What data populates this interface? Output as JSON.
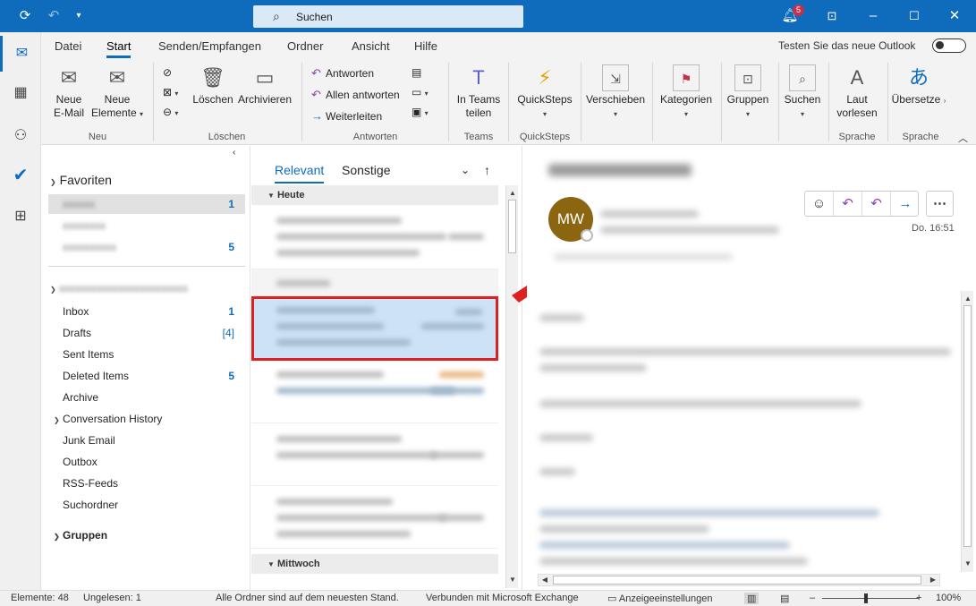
{
  "titlebar": {
    "search_label": "Suchen",
    "notification_count": "5",
    "icons": [
      "sync-icon",
      "undo-icon",
      "customize-icon",
      "bell-icon",
      "ribbon-display-icon",
      "minimize-icon",
      "maximize-icon",
      "close-icon"
    ]
  },
  "ribbon_tabs": [
    "Datei",
    "Start",
    "Senden/Empfangen",
    "Ordner",
    "Ansicht",
    "Hilfe"
  ],
  "active_tab": "Start",
  "try_new_outlook": "Testen Sie das neue Outlook",
  "ribbon": {
    "new_email": "Neue",
    "new_email_2": "E-Mail",
    "new_items": "Neue",
    "new_items_2": "Elemente",
    "group_new": "Neu",
    "delete": "Löschen",
    "archive": "Archivieren",
    "group_delete": "Löschen",
    "reply": "Antworten",
    "reply_all": "Allen antworten",
    "forward": "Weiterleiten",
    "group_respond": "Antworten",
    "teams_1": "In Teams",
    "teams_2": "teilen",
    "group_teams": "Teams",
    "quicksteps": "QuickSteps",
    "group_quicksteps": "QuickSteps",
    "move": "Verschieben",
    "categories": "Kategorien",
    "groups": "Gruppen",
    "search": "Suchen",
    "read_aloud_1": "Laut",
    "read_aloud_2": "vorlesen",
    "group_speech": "Sprache",
    "translate": "Übersetze",
    "group_speech2": "Sprache"
  },
  "folders": {
    "favorites": "Favoriten",
    "fav_counts": [
      "1",
      "",
      "5"
    ],
    "inbox": "Inbox",
    "inbox_count": "1",
    "drafts": "Drafts",
    "drafts_count": "[4]",
    "sent": "Sent Items",
    "deleted": "Deleted Items",
    "deleted_count": "5",
    "archive": "Archive",
    "conversation": "Conversation History",
    "junk": "Junk Email",
    "outbox": "Outbox",
    "rss": "RSS-Feeds",
    "search_folders": "Suchordner",
    "groups": "Gruppen"
  },
  "list": {
    "tab_relevant": "Relevant",
    "tab_other": "Sonstige",
    "group_today": "Heute",
    "group_wednesday": "Mittwoch"
  },
  "reading": {
    "avatar_initials": "MW",
    "date": "Do. 16:51"
  },
  "status": {
    "items": "Elemente: 48",
    "unread": "Ungelesen: 1",
    "sync": "Alle Ordner sind auf dem neuesten Stand.",
    "exchange": "Verbunden mit Microsoft Exchange",
    "display_settings": "Anzeigeeinstellungen",
    "zoom": "100%"
  },
  "colors": {
    "accent": "#0f6cbd",
    "highlight_box": "#e02020",
    "avatar": "#8b6510"
  }
}
